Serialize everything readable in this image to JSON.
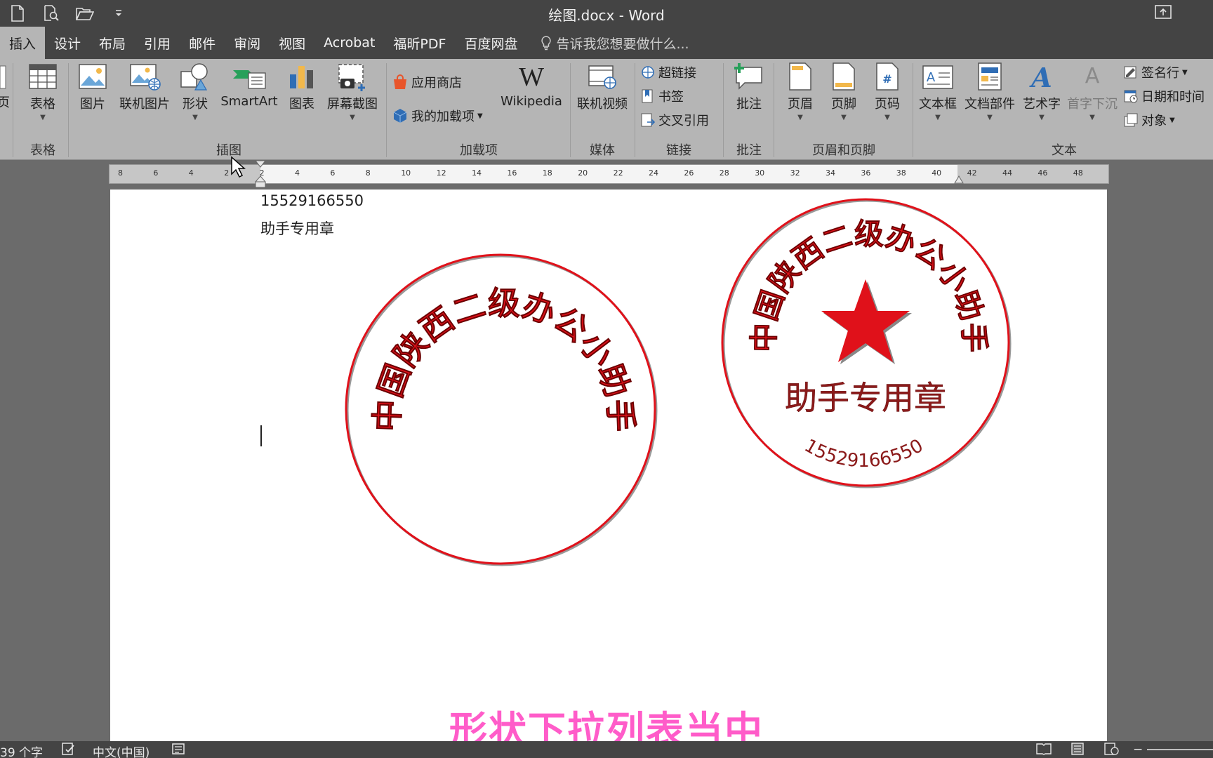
{
  "title": "绘图.docx - Word",
  "tabs": [
    {
      "label": "插入",
      "active": true
    },
    {
      "label": "设计"
    },
    {
      "label": "布局"
    },
    {
      "label": "引用"
    },
    {
      "label": "邮件"
    },
    {
      "label": "审阅"
    },
    {
      "label": "视图"
    },
    {
      "label": "Acrobat"
    },
    {
      "label": "福昕PDF"
    },
    {
      "label": "百度网盘"
    }
  ],
  "tell_me": "告诉我您想要做什么...",
  "ribbon": {
    "edge_label": "页",
    "table": "表格",
    "picture": "图片",
    "online_picture": "联机图片",
    "shapes": "形状",
    "smartart": "SmartArt",
    "chart": "图表",
    "screenshot": "屏幕截图",
    "store": "应用商店",
    "my_addins": "我的加载项",
    "wikipedia": "Wikipedia",
    "online_video": "联机视频",
    "hyperlink": "超链接",
    "bookmark": "书签",
    "cross_ref": "交叉引用",
    "comment": "批注",
    "header": "页眉",
    "footer": "页脚",
    "page_number": "页码",
    "textbox": "文本框",
    "quick_parts": "文档部件",
    "wordart": "艺术字",
    "drop_cap": "首字下沉",
    "signature": "签名行",
    "datetime": "日期和时间",
    "object": "对象"
  },
  "groups": {
    "tables": "表格",
    "illustrations": "插图",
    "addins": "加载项",
    "media": "媒体",
    "links": "链接",
    "comments": "批注",
    "header_footer": "页眉和页脚",
    "text": "文本"
  },
  "ruler_numbers": [
    "8",
    "6",
    "4",
    "2",
    "2",
    "4",
    "6",
    "8",
    "10",
    "12",
    "14",
    "16",
    "18",
    "20",
    "22",
    "24",
    "26",
    "28",
    "30",
    "32",
    "34",
    "36",
    "38",
    "40",
    "42",
    "44",
    "46",
    "48"
  ],
  "document": {
    "line1": "15529166550",
    "line2": "助手专用章"
  },
  "seal1": {
    "arc_text": "中国陕西二级办公小助手",
    "color": "#e0111a"
  },
  "seal2": {
    "arc_text": "中国陕西二级办公小助手",
    "center_text": "助手专用章",
    "number": "15529166550",
    "star_color": "#e0111a"
  },
  "subtitle": "形状下拉列表当中",
  "status": {
    "word_count": "39 个字",
    "language": "中文(中国)"
  }
}
